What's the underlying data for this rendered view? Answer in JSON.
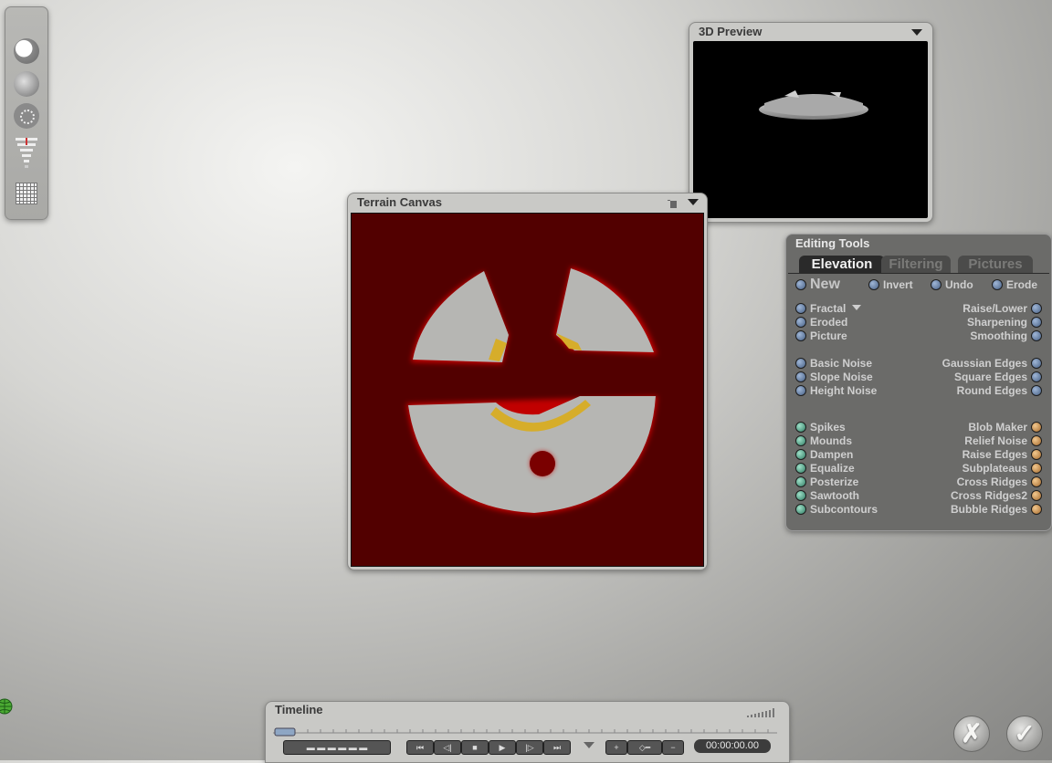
{
  "left_toolbar": {
    "buttons": [
      "sphere-solid-icon",
      "sphere-soft-icon",
      "dotted-circle-icon",
      "equalizer-icon",
      "grid-icon"
    ]
  },
  "preview": {
    "title": "3D Preview"
  },
  "terrain_canvas": {
    "title": "Terrain Canvas",
    "background_color": "#520000"
  },
  "editing_tools": {
    "title": "Editing Tools",
    "tabs": [
      {
        "label": "Elevation",
        "active": true
      },
      {
        "label": "Filtering",
        "active": false
      },
      {
        "label": "Pictures",
        "active": false
      }
    ],
    "top_row": {
      "new": "New",
      "invert": "Invert",
      "undo": "Undo",
      "erode": "Erode"
    },
    "left_tools": [
      "Fractal",
      "Eroded",
      "Picture",
      "Basic Noise",
      "Slope Noise",
      "Height Noise",
      "Spikes",
      "Mounds",
      "Dampen",
      "Equalize",
      "Posterize",
      "Sawtooth",
      "Subcontours"
    ],
    "right_tools": [
      "Raise/Lower",
      "Sharpening",
      "Smoothing",
      "Gaussian Edges",
      "Square Edges",
      "Round Edges",
      "Blob Maker",
      "Relief Noise",
      "Raise Edges",
      "Subplateaus",
      "Cross Ridges",
      "Cross Ridges2",
      "Bubble Ridges"
    ]
  },
  "timeline": {
    "title": "Timeline",
    "time": "00:00:00.00"
  },
  "footer": {
    "cancel_glyph": "✗",
    "ok_glyph": "✓"
  }
}
